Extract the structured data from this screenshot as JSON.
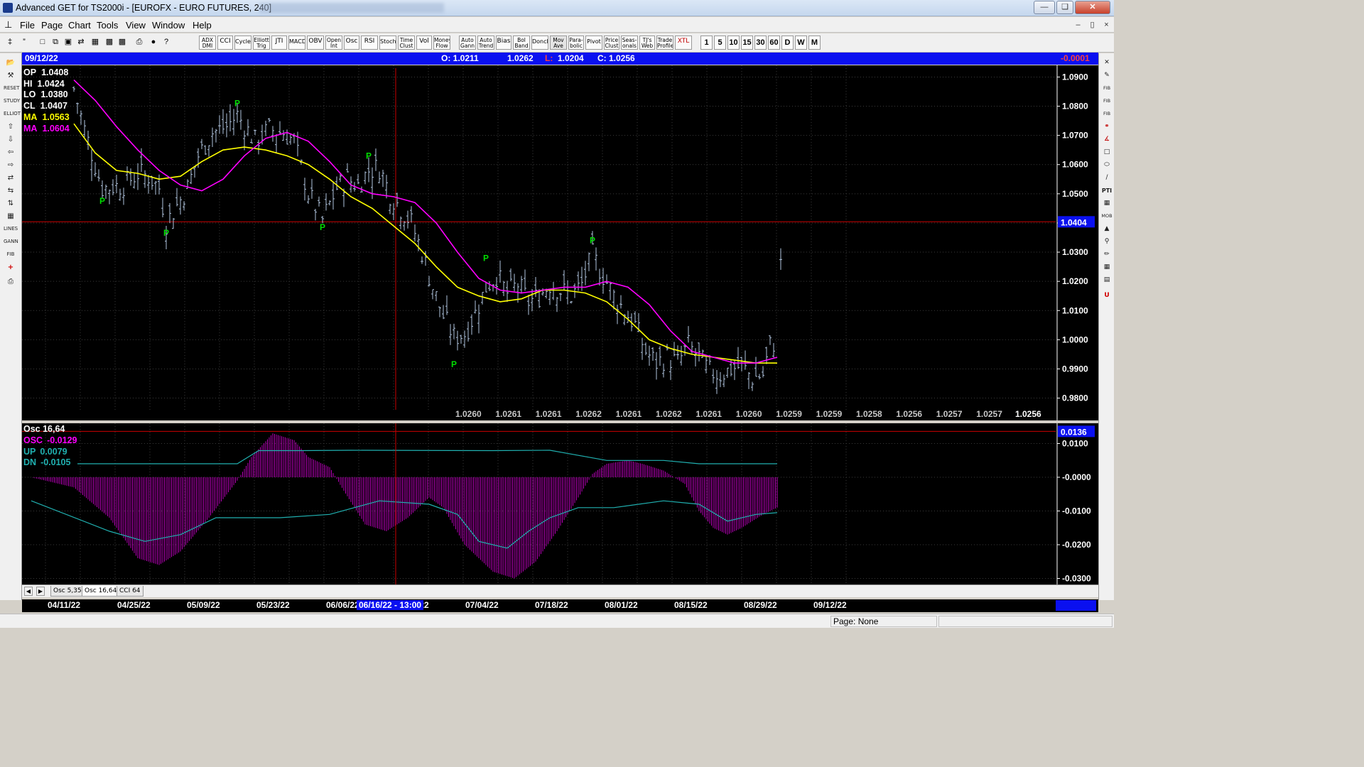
{
  "window": {
    "title": "Advanced GET for TS2000i - [EUROFX - EURO FUTURES, 240]"
  },
  "menu": [
    "File",
    "Page",
    "Chart",
    "Tools",
    "View",
    "Window",
    "Help"
  ],
  "toolbar": {
    "indicators": [
      "ADX DMI",
      "CCI",
      "Cycles",
      "Elliott Trig",
      "JTI",
      "MACD",
      "OBV",
      "Open Int",
      "Osc",
      "RSI",
      "Stoch",
      "Time Clust",
      "Vol",
      "Money Flow"
    ],
    "tools": [
      "Auto Gann",
      "Auto Trend",
      "Bias",
      "Bol Band",
      "Donch",
      "Mov Ave",
      "Para-bolic",
      "Pivot",
      "Price Clust",
      "Seas-onals",
      "TJ's Web",
      "Trade Profile",
      "XTL"
    ],
    "periods": [
      "1",
      "5",
      "10",
      "15",
      "30",
      "60",
      "D",
      "W",
      "M"
    ]
  },
  "infobar": {
    "date": "09/12/22",
    "open": "O: 1.0211",
    "high": "1.0262",
    "low_label": "L:",
    "low": "1.0204",
    "close": "C: 1.0256",
    "change": "-0.0001"
  },
  "price_header": [
    {
      "label": "OP",
      "value": "1.0408",
      "color": "#ffffff"
    },
    {
      "label": "HI",
      "value": "1.0424",
      "color": "#ffffff"
    },
    {
      "label": "LO",
      "value": "1.0380",
      "color": "#ffffff"
    },
    {
      "label": "CL",
      "value": "1.0407",
      "color": "#ffffff"
    },
    {
      "label": "MA",
      "value": "1.0563",
      "color": "#ffff00"
    },
    {
      "label": "MA",
      "value": "1.0604",
      "color": "#ff00ff"
    }
  ],
  "chart_data": [
    {
      "type": "candlestick",
      "title": "EUROFX - EURO FUTURES, 240",
      "ylim": [
        0.976,
        1.094
      ],
      "yticks": [
        "1.0900",
        "1.0800",
        "1.0700",
        "1.0600",
        "1.0500",
        "1.0400",
        "1.0300",
        "1.0200",
        "1.0100",
        "1.0000",
        "0.9900",
        "0.9800"
      ],
      "ytick_values": [
        1.09,
        1.08,
        1.07,
        1.06,
        1.05,
        1.04,
        1.03,
        1.02,
        1.01,
        1.0,
        0.99,
        0.98
      ],
      "xticks": [
        "04/11/22",
        "04/25/22",
        "05/09/22",
        "05/23/22",
        "06/06/22",
        "06/20/22",
        "07/04/22",
        "07/18/22",
        "08/01/22",
        "08/15/22",
        "08/29/22",
        "09/12/22"
      ],
      "current_price_label": "1.0404",
      "current_price": 1.0404,
      "price_row": [
        "1.0260",
        "1.0261",
        "1.0261",
        "1.0262",
        "1.0261",
        "1.0262",
        "1.0261",
        "1.0260",
        "1.0259",
        "1.0259",
        "1.0258",
        "1.0256",
        "1.0257",
        "1.0257"
      ],
      "price_row_last": "1.0256",
      "close_path": [
        [
          0,
          1.086
        ],
        [
          3,
          1.072
        ],
        [
          8,
          1.052
        ],
        [
          14,
          1.053
        ],
        [
          18,
          1.057
        ],
        [
          21,
          1.056
        ],
        [
          24,
          1.052
        ],
        [
          26,
          1.04
        ],
        [
          29,
          1.046
        ],
        [
          32,
          1.052
        ],
        [
          35,
          1.063
        ],
        [
          39,
          1.071
        ],
        [
          43,
          1.073
        ],
        [
          46,
          1.077
        ],
        [
          51,
          1.068
        ],
        [
          55,
          1.072
        ],
        [
          59,
          1.071
        ],
        [
          62,
          1.068
        ],
        [
          66,
          1.05
        ],
        [
          70,
          1.041
        ],
        [
          74,
          1.052
        ],
        [
          77,
          1.055
        ],
        [
          80,
          1.053
        ],
        [
          83,
          1.058
        ],
        [
          86,
          1.059
        ],
        [
          89,
          1.05
        ],
        [
          92,
          1.045
        ],
        [
          95,
          1.04
        ],
        [
          98,
          1.03
        ],
        [
          101,
          1.018
        ],
        [
          104,
          1.008
        ],
        [
          107,
          1.001
        ],
        [
          110,
          1.002
        ],
        [
          113,
          1.009
        ],
        [
          116,
          1.018
        ],
        [
          119,
          1.022
        ],
        [
          122,
          1.016
        ],
        [
          125,
          1.019
        ],
        [
          128,
          1.013
        ],
        [
          131,
          1.015
        ],
        [
          134,
          1.019
        ],
        [
          137,
          1.017
        ],
        [
          140,
          1.015
        ],
        [
          143,
          1.019
        ],
        [
          146,
          1.029
        ],
        [
          149,
          1.022
        ],
        [
          152,
          1.015
        ],
        [
          155,
          1.01
        ],
        [
          158,
          1.005
        ],
        [
          161,
          0.996
        ],
        [
          164,
          0.992
        ],
        [
          167,
          0.994
        ],
        [
          170,
          0.992
        ],
        [
          173,
          0.998
        ],
        [
          176,
          0.994
        ],
        [
          179,
          0.989
        ],
        [
          182,
          0.988
        ],
        [
          185,
          0.99
        ],
        [
          188,
          0.991
        ],
        [
          191,
          0.987
        ],
        [
          194,
          0.988
        ],
        [
          196,
          0.998
        ],
        [
          197,
          0.999
        ],
        [
          199,
          1.0256
        ]
      ],
      "ma_yellow": [
        [
          0,
          1.074
        ],
        [
          6,
          1.064
        ],
        [
          12,
          1.058
        ],
        [
          18,
          1.057
        ],
        [
          24,
          1.055
        ],
        [
          30,
          1.056
        ],
        [
          36,
          1.061
        ],
        [
          42,
          1.065
        ],
        [
          48,
          1.066
        ],
        [
          54,
          1.065
        ],
        [
          60,
          1.063
        ],
        [
          66,
          1.06
        ],
        [
          72,
          1.055
        ],
        [
          78,
          1.049
        ],
        [
          84,
          1.045
        ],
        [
          90,
          1.039
        ],
        [
          96,
          1.033
        ],
        [
          102,
          1.025
        ],
        [
          108,
          1.018
        ],
        [
          114,
          1.015
        ],
        [
          120,
          1.013
        ],
        [
          126,
          1.014
        ],
        [
          132,
          1.017
        ],
        [
          138,
          1.017
        ],
        [
          144,
          1.016
        ],
        [
          150,
          1.013
        ],
        [
          156,
          1.007
        ],
        [
          162,
          1.0
        ],
        [
          168,
          0.997
        ],
        [
          174,
          0.995
        ],
        [
          180,
          0.994
        ],
        [
          186,
          0.993
        ],
        [
          192,
          0.992
        ],
        [
          198,
          0.992
        ]
      ],
      "ma_magenta": [
        [
          0,
          1.089
        ],
        [
          6,
          1.082
        ],
        [
          12,
          1.073
        ],
        [
          18,
          1.065
        ],
        [
          24,
          1.058
        ],
        [
          30,
          1.053
        ],
        [
          36,
          1.051
        ],
        [
          42,
          1.055
        ],
        [
          48,
          1.063
        ],
        [
          54,
          1.069
        ],
        [
          60,
          1.071
        ],
        [
          66,
          1.068
        ],
        [
          72,
          1.061
        ],
        [
          78,
          1.053
        ],
        [
          84,
          1.05
        ],
        [
          90,
          1.049
        ],
        [
          96,
          1.047
        ],
        [
          102,
          1.04
        ],
        [
          108,
          1.03
        ],
        [
          114,
          1.021
        ],
        [
          120,
          1.017
        ],
        [
          126,
          1.016
        ],
        [
          132,
          1.017
        ],
        [
          138,
          1.018
        ],
        [
          144,
          1.018
        ],
        [
          150,
          1.02
        ],
        [
          156,
          1.018
        ],
        [
          162,
          1.012
        ],
        [
          168,
          1.003
        ],
        [
          174,
          0.996
        ],
        [
          180,
          0.994
        ],
        [
          186,
          0.992
        ],
        [
          192,
          0.992
        ],
        [
          198,
          0.994
        ]
      ],
      "pivots": [
        {
          "bar": 8,
          "price": 1.049
        },
        {
          "bar": 26,
          "price": 1.038
        },
        {
          "bar": 46,
          "price": 1.08
        },
        {
          "bar": 70,
          "price": 1.04
        },
        {
          "bar": 83,
          "price": 1.062
        },
        {
          "bar": 107,
          "price": 0.993
        },
        {
          "bar": 116,
          "price": 1.027
        },
        {
          "bar": 146,
          "price": 1.033
        }
      ],
      "pivot_label": "P"
    },
    {
      "type": "oscillator",
      "title": "Osc 16,64",
      "ylim": [
        -0.032,
        0.016
      ],
      "yticks": [
        "0.0100",
        "-0.0000",
        "-0.0100",
        "-0.0200",
        "-0.0300"
      ],
      "ytick_values": [
        0.01,
        0.0,
        -0.01,
        -0.02,
        -0.03
      ],
      "current_value_label": "0.0136",
      "current_value": 0.0136,
      "series_labels": [
        {
          "label": "OSC",
          "value": "-0.0129",
          "color": "#ff00ff"
        },
        {
          "label": "UP",
          "value": "0.0079",
          "color": "#20b0b0"
        },
        {
          "label": "DN",
          "value": "-0.0105",
          "color": "#20b0b0"
        }
      ],
      "histogram": [
        [
          -12,
          0
        ],
        [
          0,
          -0.003
        ],
        [
          10,
          -0.012
        ],
        [
          18,
          -0.024
        ],
        [
          24,
          -0.026
        ],
        [
          30,
          -0.022
        ],
        [
          38,
          -0.012
        ],
        [
          46,
          -0.001
        ],
        [
          50,
          0.006
        ],
        [
          56,
          0.013
        ],
        [
          62,
          0.011
        ],
        [
          66,
          0.006
        ],
        [
          72,
          0.003
        ],
        [
          76,
          -0.004
        ],
        [
          82,
          -0.014
        ],
        [
          88,
          -0.016
        ],
        [
          94,
          -0.012
        ],
        [
          100,
          -0.006
        ],
        [
          104,
          -0.009
        ],
        [
          110,
          -0.02
        ],
        [
          118,
          -0.028
        ],
        [
          124,
          -0.03
        ],
        [
          130,
          -0.025
        ],
        [
          136,
          -0.016
        ],
        [
          142,
          -0.006
        ],
        [
          146,
          0.001
        ],
        [
          150,
          0.004
        ],
        [
          156,
          0.005
        ],
        [
          160,
          0.004
        ],
        [
          166,
          0.002
        ],
        [
          172,
          -0.002
        ],
        [
          176,
          -0.01
        ],
        [
          180,
          -0.015
        ],
        [
          184,
          -0.017
        ],
        [
          188,
          -0.015
        ],
        [
          194,
          -0.011
        ],
        [
          198,
          -0.009
        ]
      ],
      "up_line": [
        [
          -12,
          -0.007
        ],
        [
          10,
          -0.016
        ],
        [
          20,
          -0.019
        ],
        [
          30,
          -0.017
        ],
        [
          40,
          -0.012
        ],
        [
          58,
          -0.012
        ],
        [
          72,
          -0.011
        ],
        [
          86,
          -0.007
        ],
        [
          100,
          -0.008
        ],
        [
          108,
          -0.011
        ],
        [
          114,
          -0.019
        ],
        [
          122,
          -0.021
        ],
        [
          128,
          -0.016
        ],
        [
          134,
          -0.012
        ],
        [
          142,
          -0.009
        ],
        [
          152,
          -0.009
        ],
        [
          166,
          -0.007
        ],
        [
          176,
          -0.008
        ],
        [
          184,
          -0.013
        ],
        [
          192,
          -0.011
        ],
        [
          198,
          -0.0105
        ]
      ],
      "dn_line": [
        [
          1,
          0.004
        ],
        [
          46,
          0.004
        ],
        [
          52,
          0.0079
        ],
        [
          64,
          0.0079
        ],
        [
          78,
          0.008
        ],
        [
          118,
          0.0079
        ],
        [
          134,
          0.008
        ],
        [
          150,
          0.005
        ],
        [
          166,
          0.005
        ],
        [
          176,
          0.004
        ],
        [
          198,
          0.004
        ]
      ]
    }
  ],
  "tabs": [
    "Osc 5,35",
    "Osc 16,64",
    "CCI 64"
  ],
  "cursor_date": "06/16/22 - 13:00",
  "status": {
    "page": "Page: None"
  },
  "colors": {
    "chart_bg": "#000000",
    "bar_color": "#b0c4de",
    "ma_fast": "#ffff00",
    "ma_slow": "#ff00ff",
    "pivot": "#00dd00",
    "cursor": "#cc0000",
    "osc_hist": "#cc00cc",
    "bands": "#20b0b0",
    "accent_blue": "#0a10f0"
  },
  "icons": {
    "left": [
      "folder-icon",
      "tools-icon",
      "reset-icon",
      "study-icon",
      "elliott-icon",
      "arrow-up-icon",
      "arrow-down-icon",
      "arrow-left-icon",
      "arrow-right-icon",
      "expand-h-icon",
      "compress-h-icon",
      "compress-v-icon",
      "grid-icon",
      "lines-icon",
      "gann-icon",
      "fib-icon",
      "crosshair-icon",
      "print-icon"
    ],
    "right": [
      "close-x-icon",
      "pencil-icon",
      "fib-ret-icon",
      "fib-ext-icon",
      "fib-time-icon",
      "spiral-icon",
      "fan-icon",
      "box-icon",
      "ellipse-icon",
      "channel-icon",
      "pti-icon",
      "table-icon",
      "mob-icon",
      "pointer-icon",
      "magnifier-icon",
      "marker-icon",
      "calc-icon",
      "notes-icon",
      "magnet-icon"
    ]
  }
}
